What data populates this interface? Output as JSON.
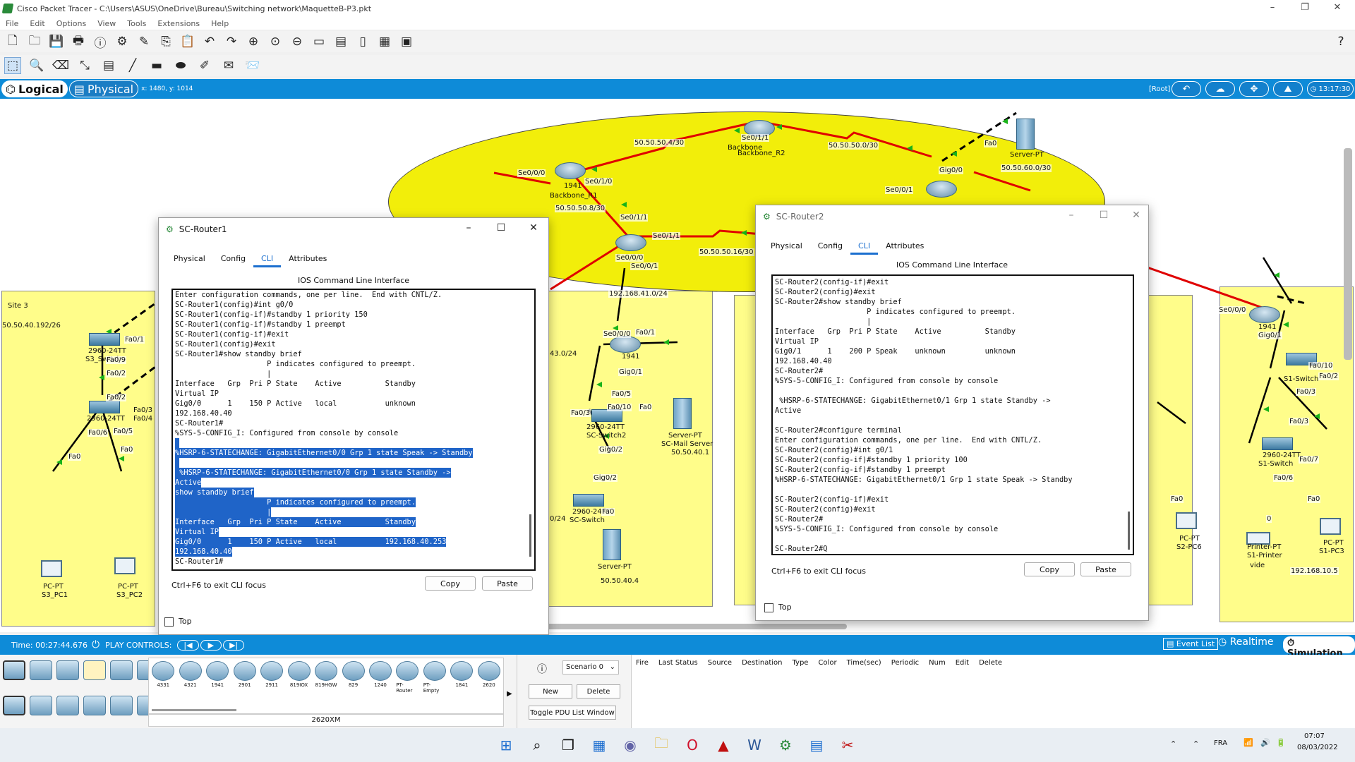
{
  "window": {
    "title": "Cisco Packet Tracer - C:\\Users\\ASUS\\OneDrive\\Bureau\\Switching network\\MaquetteB-P3.pkt"
  },
  "menu": [
    "File",
    "Edit",
    "Options",
    "View",
    "Tools",
    "Extensions",
    "Help"
  ],
  "modebar": {
    "logical": "Logical",
    "physical": "Physical",
    "coords": "x: 1480, y: 1014",
    "root": "[Root]",
    "clock": "13:17:30"
  },
  "topology": {
    "backbone_label": "Backbone",
    "site3_label": "Site 3",
    "net_site3": "50.50.40.192/26",
    "links": {
      "l1": "50.50.50.4/30",
      "l2": "50.50.50.0/30",
      "l3": "50.50.60.0/30",
      "l4": "50.50.50.8/30",
      "l5": "50.50.50.16/30",
      "l6": "192.168.41.0/24",
      "l7": "43.0/24",
      "l8": "0/24",
      "l9": "192.168.10.5"
    },
    "devices": {
      "backbone_r1": "Backbone_R1",
      "backbone_r1_model": "1941",
      "backbone_r2": "Backbone_R2",
      "server_bb": "Server-PT",
      "sw_s3": "2960-24TT",
      "sw_s3_name": "S3_Switch",
      "sw_s3b": "2960-24TT",
      "sw_s3b_name": "S3_Switch",
      "pc_s3_1": "PC-PT",
      "pc_s3_1_name": "S3_PC1",
      "pc_s3_2": "PC-PT",
      "pc_s3_2_name": "S3_PC2",
      "sc_switch2": "2960-24TT",
      "sc_switch2_name": "SC-Switch2",
      "sc_server": "Server-PT",
      "sc_server_name": "SC-Mail Server",
      "sc_server_ip": "50.50.40.1",
      "sc_switch": "2960-24TT",
      "sc_switch_name": "SC-Switch",
      "sc_server2": "Server-PT",
      "sc_server2_ip": "50.50.40.4",
      "s1_switch": "S1-Switch",
      "s1_switch2": "2960-24TT",
      "s1_switch2_name": "S1-Switch",
      "printer": "Printer-PT",
      "printer_name": "S1-Printer",
      "printer_note": "vide",
      "pc_s1": "PC-PT",
      "pc_s1_name": "S1-PC3",
      "pc_s2": "PC-PT",
      "pc_s2_name": "S2-PC6",
      "router_1941": "1941"
    },
    "ports": {
      "p1": "Se0/1/1",
      "p2": "Se0/0/0",
      "p3": "Se0/1/0",
      "p4": "Se0/1/0",
      "p5": "Se0/1/1",
      "p6": "Se0/0/0",
      "p7": "Se0/0/1",
      "p8": "Gig0/0",
      "p9": "Se0/0/1",
      "p10": "Fa0",
      "p11": "Se0/0/0",
      "p12": "Gig0/1",
      "p13": "Fa0/5",
      "p14": "Fa0/10",
      "p15": "Fa0",
      "p16": "Fa0/3",
      "p17": "Gig0/2",
      "p18": "Gig0/2",
      "p19": "Fa0",
      "p20": "Fa0/1",
      "p21": "Fa0/9",
      "p22": "Fa0/2",
      "p23": "Fa0/2",
      "p24": "Fa0/3",
      "p25": "Fa0/4",
      "p26": "Fa0/5",
      "p27": "Fa0/6",
      "p28": "Fa0",
      "p29": "Fa0",
      "p30": "Se0/0/0",
      "p31": "Gig0/1",
      "p32": "Fa0/10",
      "p33": "Fa0/2",
      "p34": "Fa0/3",
      "p35": "Fa0/3",
      "p36": "Fa0/7",
      "p37": "Fa0/6",
      "p38": "Fa0",
      "p39": "Fa0",
      "p40": "0",
      "p41": "Se0/0/1",
      "p42": "Fa0"
    }
  },
  "router1": {
    "title": "SC-Router1",
    "tabs": [
      "Physical",
      "Config",
      "CLI",
      "Attributes"
    ],
    "heading": "IOS Command Line Interface",
    "lines_plain": [
      "Enter configuration commands, one per line.  End with CNTL/Z.",
      "SC-Router1(config)#int g0/0",
      "SC-Router1(config-if)#standby 1 priority 150",
      "SC-Router1(config-if)#standby 1 preempt",
      "SC-Router1(config-if)#exit",
      "SC-Router1(config)#exit",
      "SC-Router1#show standby brief",
      "                     P indicates configured to preempt.",
      "                     |",
      "Interface   Grp  Pri P State    Active          Standby",
      "Virtual IP",
      "Gig0/0      1    150 P Active   local           unknown",
      "192.168.40.40",
      "SC-Router1#",
      "%SYS-5-CONFIG_I: Configured from console by console"
    ],
    "lines_hl": [
      "",
      "%HSRP-6-STATECHANGE: GigabitEthernet0/0 Grp 1 state Speak -> Standby",
      "",
      " %HSRP-6-STATECHANGE: GigabitEthernet0/0 Grp 1 state Standby ->",
      "Active",
      "show standby brief",
      "                     P indicates configured to preempt.",
      "                     |",
      "Interface   Grp  Pri P State    Active          Standby",
      "Virtual IP",
      "Gig0/0      1    150 P Active   local           192.168.40.253",
      "192.168.40.40"
    ],
    "last_line": "SC-Router1#",
    "hint": "Ctrl+F6 to exit CLI focus",
    "copy": "Copy",
    "paste": "Paste",
    "top": "Top"
  },
  "router2": {
    "title": "SC-Router2",
    "tabs": [
      "Physical",
      "Config",
      "CLI",
      "Attributes"
    ],
    "heading": "IOS Command Line Interface",
    "lines": [
      "SC-Router2(config-if)#exit",
      "SC-Router2(config)#exit",
      "SC-Router2#show standby brief",
      "                     P indicates configured to preempt.",
      "                     |",
      "Interface   Grp  Pri P State    Active          Standby",
      "Virtual IP",
      "Gig0/1      1    200 P Speak    unknown         unknown",
      "192.168.40.40",
      "SC-Router2#",
      "%SYS-5-CONFIG_I: Configured from console by console",
      "",
      " %HSRP-6-STATECHANGE: GigabitEthernet0/1 Grp 1 state Standby ->",
      "Active",
      "",
      "SC-Router2#configure terminal",
      "Enter configuration commands, one per line.  End with CNTL/Z.",
      "SC-Router2(config)#int g0/1",
      "SC-Router2(config-if)#standby 1 priority 100",
      "SC-Router2(config-if)#standby 1 preempt",
      "%HSRP-6-STATECHANGE: GigabitEthernet0/1 Grp 1 state Speak -> Standby",
      "",
      "SC-Router2(config-if)#exit",
      "SC-Router2(config)#exit",
      "SC-Router2#",
      "%SYS-5-CONFIG_I: Configured from console by console",
      "",
      "SC-Router2#Q"
    ],
    "hint": "Ctrl+F6 to exit CLI focus",
    "copy": "Copy",
    "paste": "Paste",
    "top": "Top"
  },
  "timebar": {
    "time": "Time: 00:27:44.676",
    "play": "PLAY CONTROLS:",
    "event_list": "Event List",
    "realtime": "Realtime",
    "simulation": "Simulation"
  },
  "device_panel": {
    "models": [
      "4331",
      "4321",
      "1941",
      "2901",
      "2911",
      "819IOX",
      "819HGW",
      "829",
      "1240",
      "PT-Router",
      "PT-Empty",
      "1841",
      "2620"
    ],
    "selected": "2620XM"
  },
  "scenario": {
    "name": "Scenario 0",
    "new": "New",
    "delete": "Delete",
    "toggle": "Toggle PDU List Window"
  },
  "pdu_columns": [
    "Fire",
    "Last Status",
    "Source",
    "Destination",
    "Type",
    "Color",
    "Time(sec)",
    "Periodic",
    "Num",
    "Edit",
    "Delete"
  ],
  "taskbar": {
    "lang": "FRA",
    "time": "07:07",
    "date": "08/03/2022"
  }
}
